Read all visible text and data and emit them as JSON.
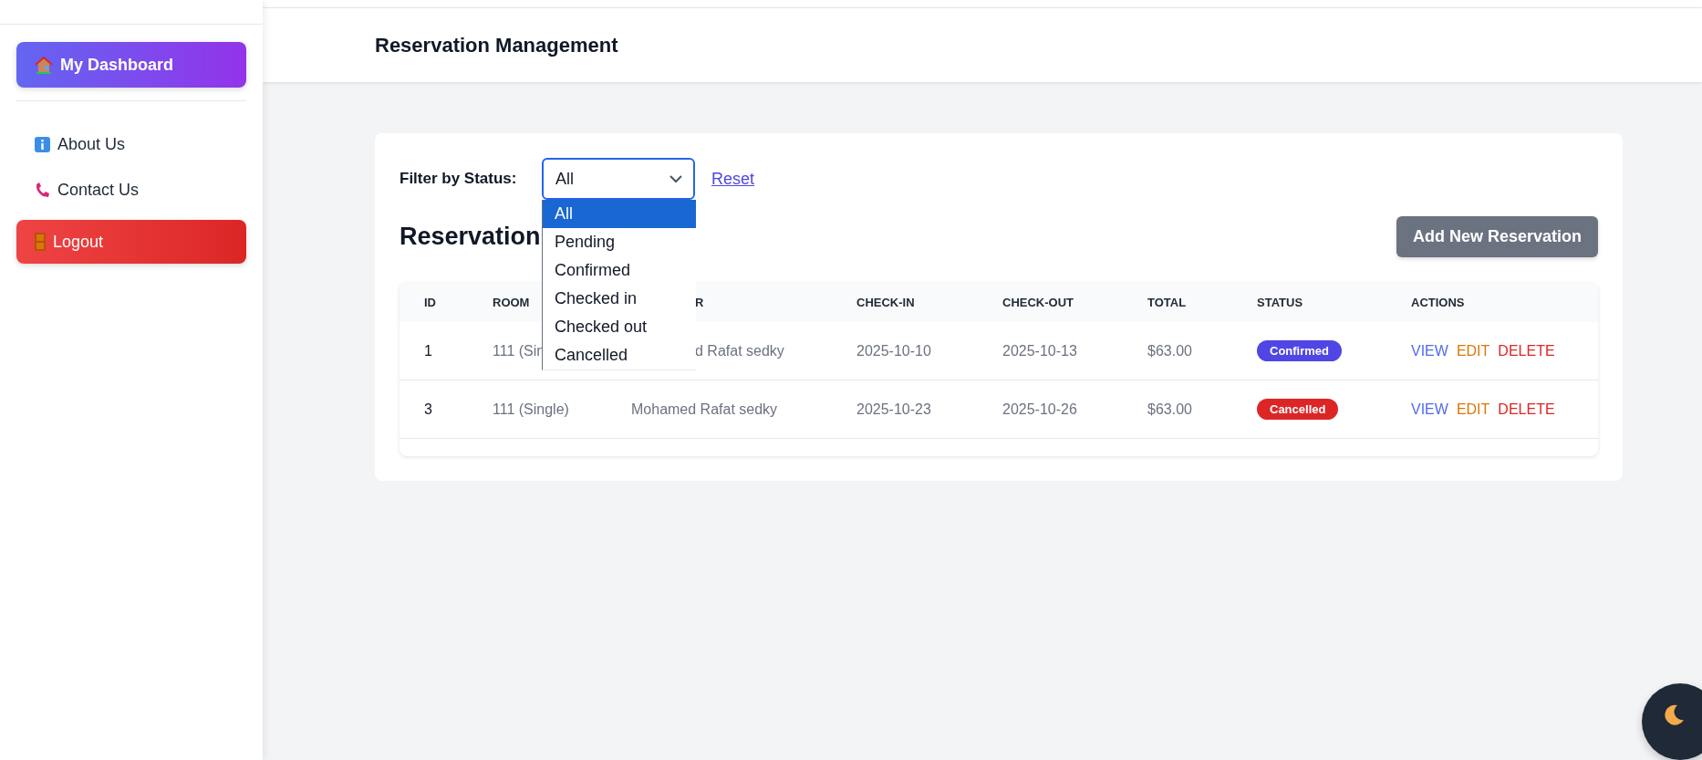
{
  "sidebar": {
    "dashboard_button": "My Dashboard",
    "links": [
      "About Us",
      "Contact Us"
    ],
    "logout_button": "Logout"
  },
  "header": {
    "title": "Reservation Management"
  },
  "filter": {
    "label": "Filter by Status:",
    "value": "All",
    "reset_link": "Reset",
    "options": [
      {
        "label": "All",
        "selected": true
      },
      {
        "label": "Pending",
        "selected": false
      },
      {
        "label": "Confirmed",
        "selected": false
      },
      {
        "label": "Checked in",
        "selected": false
      },
      {
        "label": "Checked out",
        "selected": false
      },
      {
        "label": "Cancelled",
        "selected": false
      }
    ]
  },
  "section_title": "Reservation",
  "add_button": "Add New Reservation",
  "table": {
    "columns": [
      {
        "label": "ID"
      },
      {
        "label": "ROOM"
      },
      {
        "label": "R",
        "clipped": true
      },
      {
        "label": "CHECK-IN"
      },
      {
        "label": "CHECK-OUT"
      },
      {
        "label": "TOTAL"
      },
      {
        "label": "STATUS"
      },
      {
        "label": "ACTIONS"
      }
    ],
    "rows": [
      {
        "id": "1",
        "room": "111 (Sin",
        "guest": "d Rafat sedky",
        "guest_clipped": true,
        "check_in": "2025-10-10",
        "check_out": "2025-10-13",
        "total": "$63.00",
        "status": {
          "label": "Confirmed",
          "color": "#4f46e5"
        },
        "actions": [
          {
            "kind": "view",
            "label": "VIEW"
          },
          {
            "kind": "edit",
            "label": "EDIT"
          },
          {
            "kind": "delete",
            "label": "DELETE"
          }
        ]
      },
      {
        "id": "3",
        "room": "111 (Single)",
        "guest": "Mohamed Rafat sedky",
        "check_in": "2025-10-23",
        "check_out": "2025-10-26",
        "total": "$63.00",
        "status": {
          "label": "Cancelled",
          "color": "#dc2626"
        },
        "actions": [
          {
            "kind": "view",
            "label": "VIEW"
          },
          {
            "kind": "edit",
            "label": "EDIT"
          },
          {
            "kind": "delete",
            "label": "DELETE"
          }
        ]
      }
    ]
  }
}
